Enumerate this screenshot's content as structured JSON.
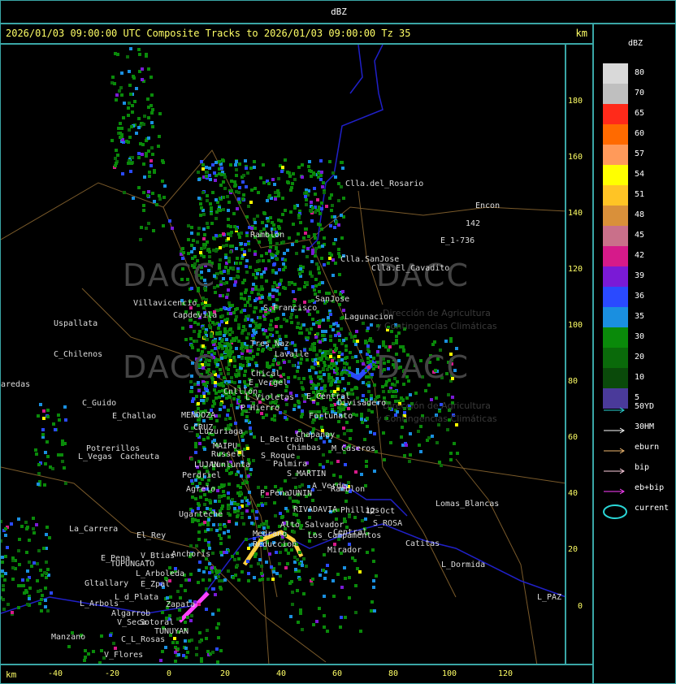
{
  "header": {
    "units": "dBZ"
  },
  "map": {
    "title": "2026/01/03 09:00:00 UTC Composite Tracks to 2026/01/03 09:00:00 Tz 35",
    "km_label_top": "km",
    "km_label_bottom": "km",
    "y_ticks": [
      "180",
      "160",
      "140",
      "120",
      "100",
      "80",
      "60",
      "40",
      "20",
      "0"
    ],
    "x_ticks": [
      "-40",
      "-20",
      "0",
      "20",
      "40",
      "60",
      "80",
      "100",
      "120"
    ],
    "watermark": "DACC",
    "watermark_sub1": "Dirección de Agricultura",
    "watermark_sub2": "y Contingencias Climáticas",
    "places": [
      "Clla.del_Rosario",
      "Encon",
      "E_1-736",
      "142",
      "Ramblon",
      "Clla.SanJose",
      "Clla.El_Cavadito",
      "Villavicencio",
      "Capdevila",
      "S.Francisco",
      "SanJose",
      "Uspallata",
      "Lagunacion",
      "C_Chilenos",
      "Tres_Naz",
      "Lavalle",
      "aredas",
      "Chical",
      "E_Vergel",
      "Cnlllon",
      "L_Violetas",
      "C_Guido",
      "P_Hierro",
      "E_Central",
      "Divisadero",
      "E_Challao",
      "MENDOZA",
      "G_CRUZ",
      "Fortunato",
      "Luzuriaga",
      "L_Beltran",
      "Chapanay",
      "Potrerillos",
      "MAIPU",
      "Russell",
      "Chimbas",
      "M_Caseros",
      "L_Vegas",
      "Cacheuta",
      "S_Roque",
      "Palmira",
      "LUJAN",
      "Lunlunta",
      "S_MARTIN",
      "Perdriel",
      "Agrelo",
      "A_Verde",
      "Ramblon",
      "P_Pena",
      "JUNIN",
      "Ugarteche",
      "RIVADAVIA",
      "Phillips",
      "12_Oct",
      "Lomas_Blancas",
      "S_ROSA",
      "La_Carrera",
      "El_Rey",
      "Medrano",
      "Reduccion",
      "Alto_Salvador",
      "Los_Campamentos",
      "Central",
      "Catitas",
      "E_Pena",
      "V_Btias",
      "Anchoris",
      "Mirador",
      "TUPUNGATO",
      "L_Dormida",
      "L_Arboleda",
      "Gltallary",
      "E_Zpal",
      "L_d_Plata",
      "L_PAZ",
      "L_Arbols",
      "Algarrob",
      "Zapata",
      "V_Seca",
      "Sotoral",
      "TUNUYAN",
      "Manzano",
      "C_L_Rosas",
      "V_Flores"
    ]
  },
  "legend": {
    "title": "dBZ",
    "scale": [
      {
        "label": "80",
        "color": "#d9d9d9"
      },
      {
        "label": "70",
        "color": "#bfbfbf"
      },
      {
        "label": "65",
        "color": "#ff2a1a"
      },
      {
        "label": "60",
        "color": "#ff6a00"
      },
      {
        "label": "57",
        "color": "#ff9a5a"
      },
      {
        "label": "54",
        "color": "#ffff00"
      },
      {
        "label": "51",
        "color": "#ffc425"
      },
      {
        "label": "48",
        "color": "#d9903a"
      },
      {
        "label": "45",
        "color": "#c9708a"
      },
      {
        "label": "42",
        "color": "#d61a8a"
      },
      {
        "label": "39",
        "color": "#7a1ad6"
      },
      {
        "label": "36",
        "color": "#2a4aff"
      },
      {
        "label": "35",
        "color": "#1a8fe0"
      },
      {
        "label": "30",
        "color": "#0a8a0a"
      },
      {
        "label": "20",
        "color": "#0a6a0a"
      },
      {
        "label": "10",
        "color": "#0a4a0a"
      },
      {
        "label": "5",
        "color": "#4a3a9a"
      }
    ],
    "tracks": [
      {
        "label": "50YD",
        "color": "#2ad6d6"
      },
      {
        "label": "30HM",
        "color": "#ffffff"
      },
      {
        "label": "eburn",
        "color": "#f0b870"
      },
      {
        "label": "bip",
        "color": "#ffd0e0"
      },
      {
        "label": "eb+bip",
        "color": "#ff40ff"
      }
    ],
    "current_label": "current",
    "current_color": "#2ad6d6"
  }
}
